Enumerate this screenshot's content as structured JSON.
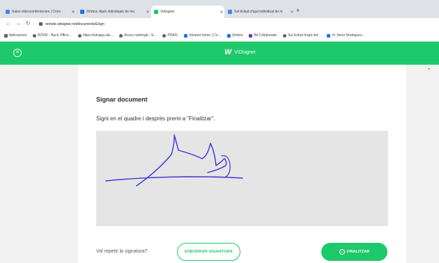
{
  "browser": {
    "tabs": [
      {
        "label": "Sales videoconferències | Conv",
        "favicon_color": "#4285f4"
      },
      {
        "label": "Zimbra: Ajuts individuals de mo",
        "favicon_color": "#1a73e8"
      },
      {
        "label": "Vidsigner",
        "favicon_color": "#1ec96b"
      },
      {
        "label": "Sol·licitud d'ajut individual de m",
        "favicon_color": "#4285f4"
      }
    ],
    "url": "remote.vidsigner.net/documents/Esign",
    "bookmarks": [
      {
        "label": "Aplicacions",
        "color": "#5f6368"
      },
      {
        "label": "BOOK - Back Office...",
        "color": "#5f6368"
      },
      {
        "label": "https://sdsapp.uib...",
        "color": "#5f6368"
      },
      {
        "label": "Acces restringit - S...",
        "color": "#5f6368"
      },
      {
        "label": "PDAIV",
        "color": "#5f6368"
      },
      {
        "label": "Intranet home | Co...",
        "color": "#1a73e8"
      },
      {
        "label": "Zimbra",
        "color": "#1a73e8"
      },
      {
        "label": "Bit Collaborate",
        "color": "#673ab7"
      },
      {
        "label": "Sol·licitud d'ajut ind...",
        "color": "#5f6368"
      },
      {
        "label": "Vr. Amor Rodriguez...",
        "color": "#1a73e8"
      }
    ]
  },
  "app": {
    "brand_mark": "W",
    "brand_name": "VIDsigner",
    "accent_color": "#1ec96b"
  },
  "card": {
    "title": "Signar document",
    "instruction": "Signi en el quadre i després premi a \"Finalitzar\".",
    "repeat_label": "Vol repetir la signatura?",
    "erase_label": "ESBORRAR SIGNATURA",
    "finish_label": "FINALITZAR"
  },
  "icons": {
    "close": "close-circle-icon",
    "finish": "check-circle-icon",
    "lock": "lock-icon"
  }
}
